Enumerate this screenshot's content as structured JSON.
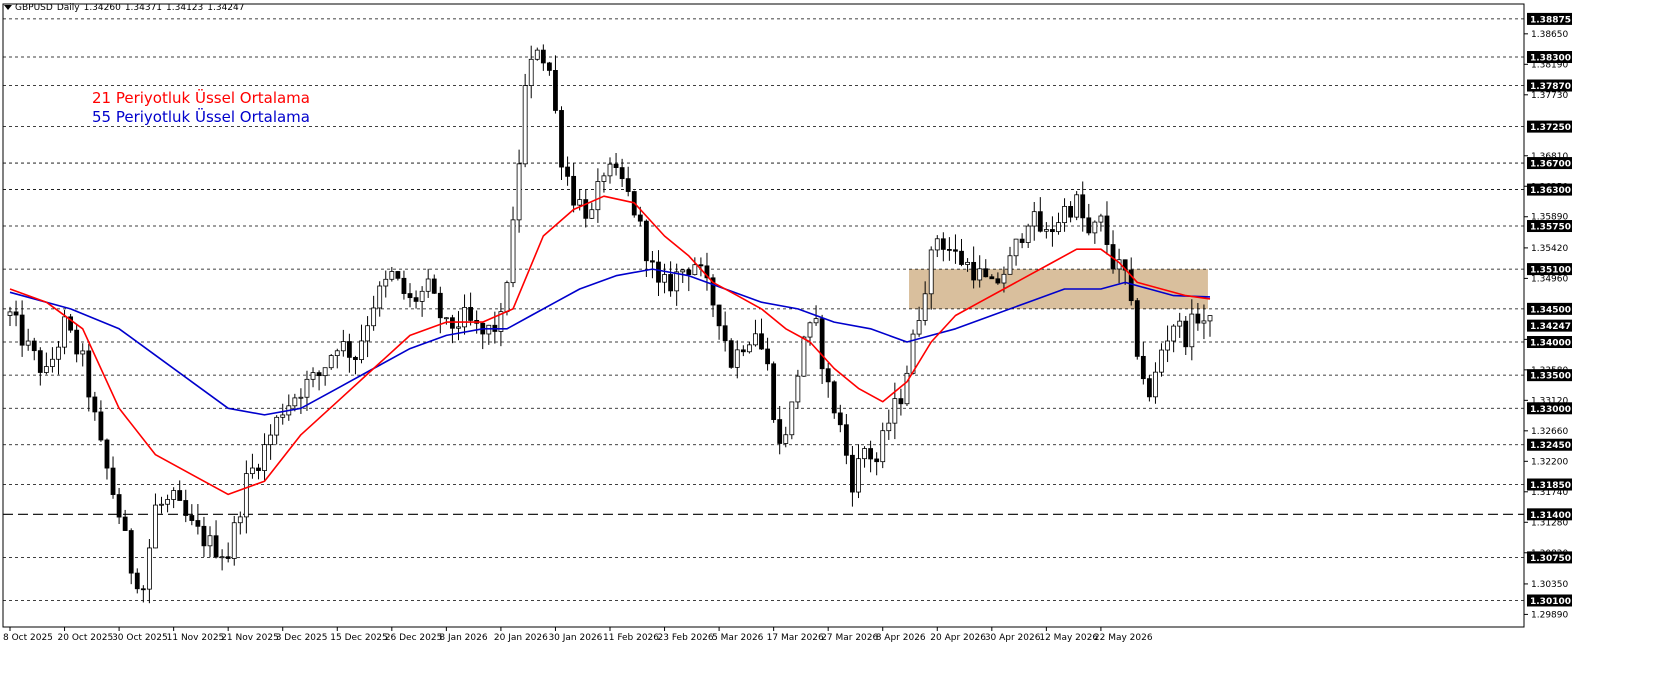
{
  "header": {
    "symbol": "GBPUSD",
    "timeframe": "Daily",
    "ohlc": [
      "1.34260",
      "1.34371",
      "1.34123",
      "1.34247"
    ]
  },
  "colors": {
    "ema21": "#ff0000",
    "ema55": "#0000cc",
    "zone": "#d2b48c",
    "candle": "#000000",
    "grid": "#000000",
    "price_label_bg": "#000000",
    "price_label_text": "#ffffff"
  },
  "chart_data": {
    "type": "candlestick",
    "legend": [
      {
        "name": "21 Periyotluk Üssel Ortalama",
        "color": "#ff0000"
      },
      {
        "name": "55 Periyotluk Üssel Ortalama",
        "color": "#0000cc"
      }
    ],
    "ylim": [
      1.297,
      1.391
    ],
    "y_ticks": [
      "1.38650",
      "1.38190",
      "1.37730",
      "1.36810",
      "1.36350",
      "1.35890",
      "1.35420",
      "1.34960",
      "1.34040",
      "1.33580",
      "1.33120",
      "1.32660",
      "1.32200",
      "1.31740",
      "1.31280",
      "1.30820",
      "1.30350",
      "1.29890"
    ],
    "levels": [
      "1.38875",
      "1.38300",
      "1.37870",
      "1.37250",
      "1.36700",
      "1.36300",
      "1.35750",
      "1.35100",
      "1.34500",
      "1.34000",
      "1.33500",
      "1.33000",
      "1.32450",
      "1.31850",
      "1.31400",
      "1.30750",
      "1.30100"
    ],
    "current_price": "1.34247",
    "dashed_level": "1.31400",
    "zone": {
      "low": 1.345,
      "high": 1.351,
      "from_index": 149,
      "to_index": 197
    },
    "x_labels": [
      {
        "label": "8 Oct 2025",
        "index": 0
      },
      {
        "label": "20 Oct 2025",
        "index": 9
      },
      {
        "label": "30 Oct 2025",
        "index": 18
      },
      {
        "label": "11 Nov 2025",
        "index": 27
      },
      {
        "label": "21 Nov 2025",
        "index": 36
      },
      {
        "label": "3 Dec 2025",
        "index": 45
      },
      {
        "label": "15 Dec 2025",
        "index": 54
      },
      {
        "label": "26 Dec 2025",
        "index": 63
      },
      {
        "label": "8 Jan 2026",
        "index": 72
      },
      {
        "label": "20 Jan 2026",
        "index": 81
      },
      {
        "label": "30 Jan 2026",
        "index": 90
      },
      {
        "label": "11 Feb 2026",
        "index": 99
      },
      {
        "label": "23 Feb 2026",
        "index": 108
      },
      {
        "label": "5 Mar 2026",
        "index": 117
      },
      {
        "label": "17 Mar 2026",
        "index": 126
      },
      {
        "label": "27 Mar 2026",
        "index": 135
      },
      {
        "label": "8 Apr 2026",
        "index": 144
      },
      {
        "label": "20 Apr 2026",
        "index": 153
      },
      {
        "label": "30 Apr 2026",
        "index": 162
      },
      {
        "label": "12 May 2026",
        "index": 171
      },
      {
        "label": "22 May 2026",
        "index": 180
      }
    ],
    "anchors": [
      [
        0,
        1.344
      ],
      [
        3,
        1.339
      ],
      [
        6,
        1.335
      ],
      [
        9,
        1.3425
      ],
      [
        12,
        1.337
      ],
      [
        15,
        1.324
      ],
      [
        18,
        1.314
      ],
      [
        20,
        1.306
      ],
      [
        22,
        1.303
      ],
      [
        24,
        1.315
      ],
      [
        27,
        1.316
      ],
      [
        30,
        1.312
      ],
      [
        33,
        1.3095
      ],
      [
        36,
        1.308
      ],
      [
        39,
        1.319
      ],
      [
        42,
        1.324
      ],
      [
        45,
        1.33
      ],
      [
        48,
        1.333
      ],
      [
        51,
        1.335
      ],
      [
        54,
        1.34
      ],
      [
        57,
        1.338
      ],
      [
        60,
        1.346
      ],
      [
        63,
        1.35
      ],
      [
        66,
        1.346
      ],
      [
        69,
        1.348
      ],
      [
        72,
        1.342
      ],
      [
        75,
        1.3435
      ],
      [
        78,
        1.341
      ],
      [
        81,
        1.343
      ],
      [
        83,
        1.357
      ],
      [
        85,
        1.378
      ],
      [
        87,
        1.385
      ],
      [
        89,
        1.381
      ],
      [
        91,
        1.368
      ],
      [
        93,
        1.362
      ],
      [
        96,
        1.359
      ],
      [
        98,
        1.366
      ],
      [
        101,
        1.364
      ],
      [
        103,
        1.36
      ],
      [
        105,
        1.354
      ],
      [
        107,
        1.348
      ],
      [
        109,
        1.349
      ],
      [
        111,
        1.351
      ],
      [
        113,
        1.352
      ],
      [
        115,
        1.348
      ],
      [
        117,
        1.344
      ],
      [
        119,
        1.337
      ],
      [
        121,
        1.34
      ],
      [
        123,
        1.342
      ],
      [
        125,
        1.336
      ],
      [
        127,
        1.324
      ],
      [
        129,
        1.33
      ],
      [
        131,
        1.341
      ],
      [
        133,
        1.342
      ],
      [
        135,
        1.333
      ],
      [
        137,
        1.327
      ],
      [
        139,
        1.319
      ],
      [
        141,
        1.324
      ],
      [
        143,
        1.322
      ],
      [
        145,
        1.328
      ],
      [
        147,
        1.332
      ],
      [
        149,
        1.34
      ],
      [
        151,
        1.349
      ],
      [
        153,
        1.356
      ],
      [
        156,
        1.353
      ],
      [
        159,
        1.351
      ],
      [
        162,
        1.348
      ],
      [
        165,
        1.352
      ],
      [
        168,
        1.359
      ],
      [
        171,
        1.356
      ],
      [
        174,
        1.36
      ],
      [
        176,
        1.361
      ],
      [
        178,
        1.356
      ],
      [
        180,
        1.358
      ],
      [
        182,
        1.352
      ],
      [
        184,
        1.35
      ],
      [
        186,
        1.339
      ],
      [
        188,
        1.331
      ],
      [
        190,
        1.339
      ],
      [
        192,
        1.343
      ],
      [
        194,
        1.341
      ],
      [
        196,
        1.344
      ],
      [
        198,
        1.3425
      ]
    ],
    "ema21": [
      [
        0,
        1.348
      ],
      [
        6,
        1.346
      ],
      [
        12,
        1.342
      ],
      [
        18,
        1.33
      ],
      [
        24,
        1.323
      ],
      [
        30,
        1.32
      ],
      [
        36,
        1.317
      ],
      [
        42,
        1.319
      ],
      [
        48,
        1.326
      ],
      [
        54,
        1.331
      ],
      [
        60,
        1.336
      ],
      [
        66,
        1.341
      ],
      [
        72,
        1.343
      ],
      [
        78,
        1.343
      ],
      [
        83,
        1.345
      ],
      [
        88,
        1.356
      ],
      [
        93,
        1.36
      ],
      [
        98,
        1.362
      ],
      [
        103,
        1.361
      ],
      [
        108,
        1.356
      ],
      [
        112,
        1.353
      ],
      [
        116,
        1.349
      ],
      [
        120,
        1.347
      ],
      [
        124,
        1.345
      ],
      [
        128,
        1.342
      ],
      [
        132,
        1.34
      ],
      [
        136,
        1.336
      ],
      [
        140,
        1.333
      ],
      [
        144,
        1.331
      ],
      [
        148,
        1.334
      ],
      [
        152,
        1.34
      ],
      [
        156,
        1.344
      ],
      [
        160,
        1.346
      ],
      [
        164,
        1.348
      ],
      [
        168,
        1.35
      ],
      [
        172,
        1.352
      ],
      [
        176,
        1.354
      ],
      [
        180,
        1.354
      ],
      [
        183,
        1.352
      ],
      [
        186,
        1.349
      ],
      [
        190,
        1.348
      ],
      [
        194,
        1.347
      ],
      [
        198,
        1.3465
      ]
    ],
    "ema55": [
      [
        0,
        1.3475
      ],
      [
        10,
        1.345
      ],
      [
        18,
        1.342
      ],
      [
        24,
        1.338
      ],
      [
        30,
        1.334
      ],
      [
        36,
        1.33
      ],
      [
        42,
        1.329
      ],
      [
        48,
        1.33
      ],
      [
        54,
        1.333
      ],
      [
        60,
        1.336
      ],
      [
        66,
        1.339
      ],
      [
        72,
        1.341
      ],
      [
        78,
        1.342
      ],
      [
        82,
        1.342
      ],
      [
        86,
        1.344
      ],
      [
        90,
        1.346
      ],
      [
        94,
        1.348
      ],
      [
        100,
        1.35
      ],
      [
        106,
        1.351
      ],
      [
        112,
        1.35
      ],
      [
        118,
        1.348
      ],
      [
        124,
        1.346
      ],
      [
        130,
        1.345
      ],
      [
        136,
        1.343
      ],
      [
        142,
        1.342
      ],
      [
        148,
        1.34
      ],
      [
        152,
        1.341
      ],
      [
        156,
        1.342
      ],
      [
        162,
        1.344
      ],
      [
        168,
        1.346
      ],
      [
        174,
        1.348
      ],
      [
        180,
        1.348
      ],
      [
        184,
        1.349
      ],
      [
        188,
        1.348
      ],
      [
        192,
        1.347
      ],
      [
        198,
        1.3468
      ]
    ]
  }
}
